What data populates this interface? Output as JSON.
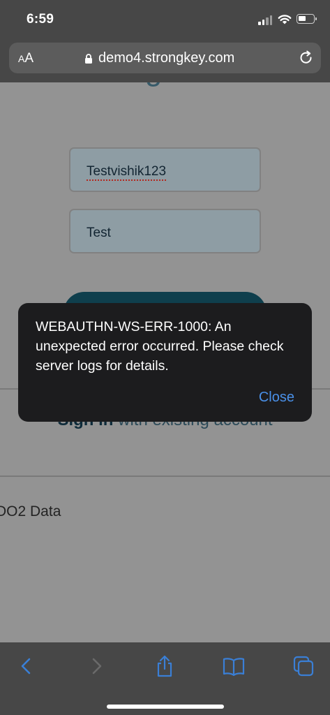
{
  "status_bar": {
    "time": "6:59"
  },
  "browser": {
    "text_size_label_small": "A",
    "text_size_label_large": "A",
    "url": "demo4.strongkey.com"
  },
  "page": {
    "heading": "Register",
    "username_value": "Testvishik123",
    "display_name_value": "Test",
    "signin_bold": "Sign in",
    "signin_rest": " with existing account",
    "fido_link_text": "DO2 Data"
  },
  "alert": {
    "message": "WEBAUTHN-WS-ERR-1000: An unexpected error occurred. Please check server logs for details.",
    "close_label": "Close"
  },
  "colors": {
    "alert_background": "#1c1c1e",
    "link_blue": "#4a90e8",
    "toolbar_icon_blue": "#3a7fd6",
    "page_heading_teal": "#375a69"
  },
  "toolbar_icons": [
    "back-icon",
    "forward-icon",
    "share-icon",
    "bookmarks-icon",
    "tabs-icon"
  ]
}
